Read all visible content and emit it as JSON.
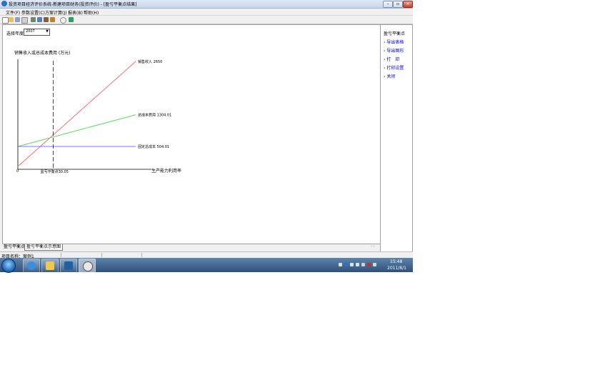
{
  "window": {
    "title": "投资项目经济评价系统-新建项目财务(投资评价) - [盈亏平衡点结果]",
    "buttons": {
      "minimize": "–",
      "restore": "▫",
      "close": "×"
    }
  },
  "menu": [
    "文件(F)",
    "参数设置(C)",
    "方案计算(J)",
    "报表(B)",
    "帮助(H)"
  ],
  "year_selector": {
    "label": "选择年度",
    "value": "2007"
  },
  "chart_data": {
    "type": "line",
    "title": "",
    "ylabel": "销售收入或总成本费用 (万元)",
    "xlabel": "生产能力利用率",
    "x_origin_label": "0",
    "x": [
      0,
      100
    ],
    "series": [
      {
        "name": "销售收入",
        "label": "销售收入 2650",
        "values": [
          0,
          2650
        ],
        "color": "#ff6666"
      },
      {
        "name": "总成本费用",
        "label": "总成本费用 1304.01",
        "values": [
          504.01,
          1304.01
        ],
        "color": "#44dd44"
      },
      {
        "name": "固定总成本",
        "label": "固定总成本 504.01",
        "values": [
          504.01,
          504.01
        ],
        "color": "#6666ff"
      }
    ],
    "breakeven": {
      "x": 30.05,
      "label": "盈亏平衡点30.05"
    }
  },
  "right_panel": {
    "title": "盈亏平衡点",
    "links": [
      "导出表格",
      "导出图形",
      "打　印",
      "打印设置",
      "关闭"
    ]
  },
  "tabs": [
    "盈亏平衡点",
    "盈亏平衡点示意图"
  ],
  "tab_scroll": "‹ ›",
  "status": {
    "project": "项目名称：案例1"
  },
  "taskbar": {
    "time": "15:48",
    "date": "2011/8/1"
  }
}
